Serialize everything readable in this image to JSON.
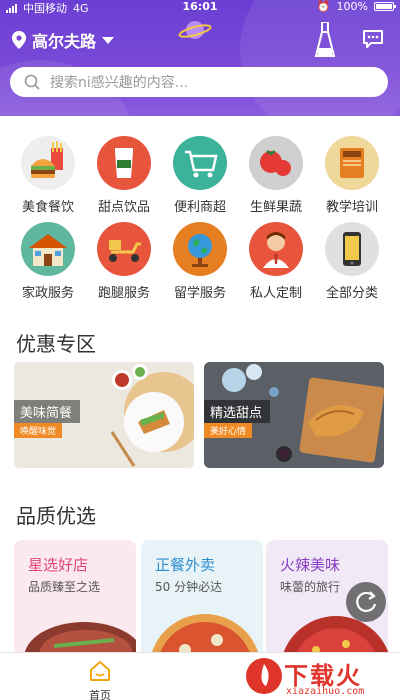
{
  "status": {
    "carrier": "中国移动",
    "network": "4G",
    "time": "16:01",
    "battery": "100%"
  },
  "header": {
    "location": "高尔夫路",
    "search_placeholder": "搜索ni感兴趣的内容..."
  },
  "categories": [
    {
      "label": "美食餐饮",
      "icon": "burger-fries-icon"
    },
    {
      "label": "甜点饮品",
      "icon": "coffee-cup-icon"
    },
    {
      "label": "便利商超",
      "icon": "shopping-cart-icon"
    },
    {
      "label": "生鲜果蔬",
      "icon": "tomato-icon"
    },
    {
      "label": "教学培训",
      "icon": "book-icon"
    },
    {
      "label": "家政服务",
      "icon": "house-icon"
    },
    {
      "label": "跑腿服务",
      "icon": "scooter-icon"
    },
    {
      "label": "留学服务",
      "icon": "globe-icon"
    },
    {
      "label": "私人定制",
      "icon": "person-icon"
    },
    {
      "label": "全部分类",
      "icon": "phone-icon"
    }
  ],
  "promo_section": {
    "title": "优惠专区",
    "cards": [
      {
        "title": "美味简餐",
        "subtitle": "唤醒味觉"
      },
      {
        "title": "精选甜点",
        "subtitle": "美好心情"
      }
    ]
  },
  "quality_section": {
    "title": "品质优选",
    "cards": [
      {
        "title": "星选好店",
        "subtitle": "品质臻至之选",
        "color": "#e0457a"
      },
      {
        "title": "正餐外卖",
        "subtitle": "50 分钟必达",
        "color": "#2e8fd0"
      },
      {
        "title": "火辣美味",
        "subtitle": "味蕾的旅行",
        "color": "#8a3fc2"
      }
    ]
  },
  "tabbar": {
    "home_label": "首页"
  },
  "watermark": {
    "brand": "下载火",
    "url": "xiazaihuo.com"
  },
  "colors": {
    "header": "#7a4ad6",
    "accent_orange": "#f08a24",
    "watermark_red": "#e0352b"
  }
}
